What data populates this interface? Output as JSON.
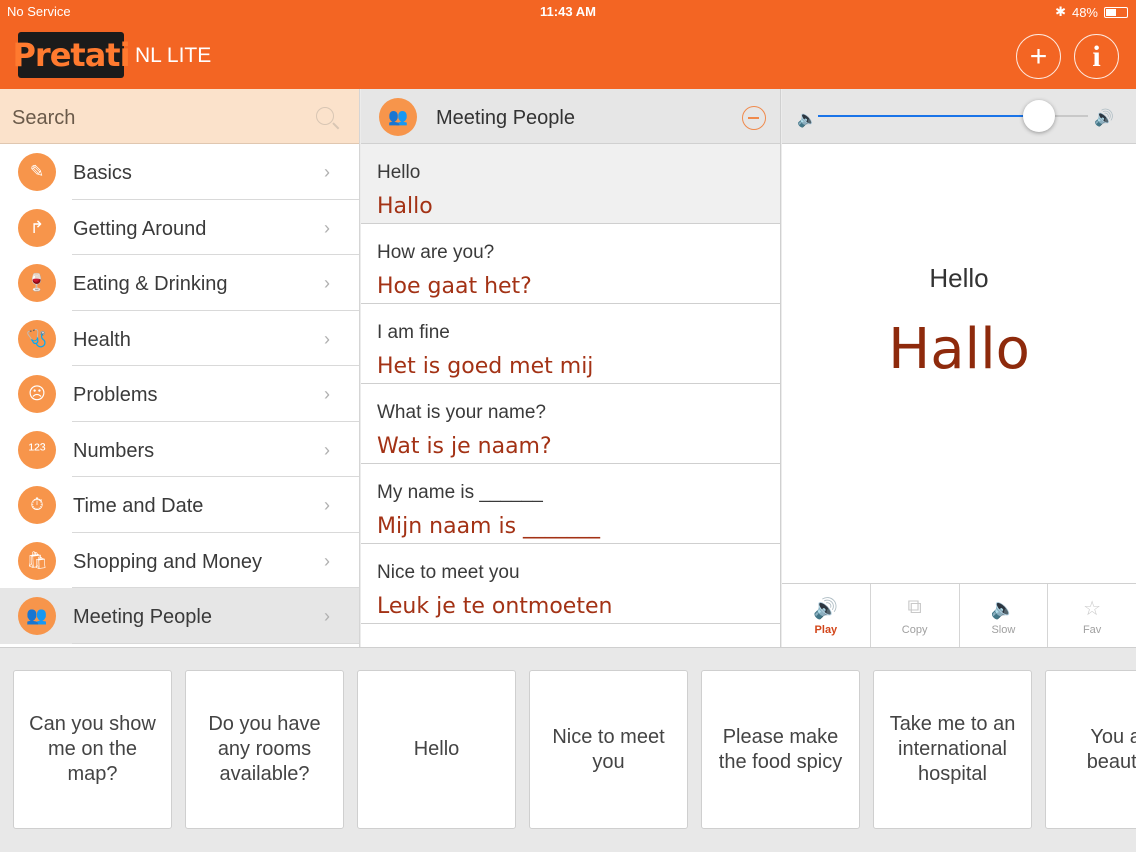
{
  "status": {
    "carrier": "No Service",
    "time": "11:43 AM",
    "battery": "48%"
  },
  "header": {
    "logo": "Pretati",
    "title": "NL LITE",
    "add_icon": "+",
    "info_icon": "i"
  },
  "search": {
    "placeholder": "Search"
  },
  "categories": [
    {
      "label": "Basics",
      "icon": "✎"
    },
    {
      "label": "Getting Around",
      "icon": "↱"
    },
    {
      "label": "Eating & Drinking",
      "icon": "🍷"
    },
    {
      "label": "Health",
      "icon": "🩺"
    },
    {
      "label": "Problems",
      "icon": "☹"
    },
    {
      "label": "Numbers",
      "icon": "¹²³"
    },
    {
      "label": "Time and Date",
      "icon": "⏱"
    },
    {
      "label": "Shopping and Money",
      "icon": "🛍"
    },
    {
      "label": "Meeting People",
      "icon": "👥"
    }
  ],
  "phrase_list": {
    "title": "Meeting People",
    "items": [
      {
        "en": "Hello",
        "nl": "Hallo"
      },
      {
        "en": "How are you?",
        "nl": "Hoe gaat het?"
      },
      {
        "en": "I am fine",
        "nl": "Het is goed met mij"
      },
      {
        "en": "What is your name?",
        "nl": "Wat is je naam?"
      },
      {
        "en": "My name is ______",
        "nl": "Mijn naam is _______"
      },
      {
        "en": "Nice to meet you",
        "nl": "Leuk je te ontmoeten"
      }
    ]
  },
  "volume": {
    "level": 0.82
  },
  "detail": {
    "en": "Hello",
    "nl": "Hallo"
  },
  "actions": [
    {
      "label": "Play",
      "icon": "🔊",
      "active": true
    },
    {
      "label": "Copy",
      "icon": "⧉",
      "active": false
    },
    {
      "label": "Slow",
      "icon": "🔈",
      "active": false
    },
    {
      "label": "Fav",
      "icon": "☆",
      "active": false
    }
  ],
  "cards": [
    "Can you show me on the map?",
    "Do you have any rooms available?",
    "Hello",
    "Nice to meet you",
    "Please make the food spicy",
    "Take me to an international hospital",
    "You are beautiful"
  ],
  "colors": {
    "brand": "#f36523",
    "accent": "#f7954b",
    "translation": "#a33215",
    "slider": "#1a74e8"
  }
}
